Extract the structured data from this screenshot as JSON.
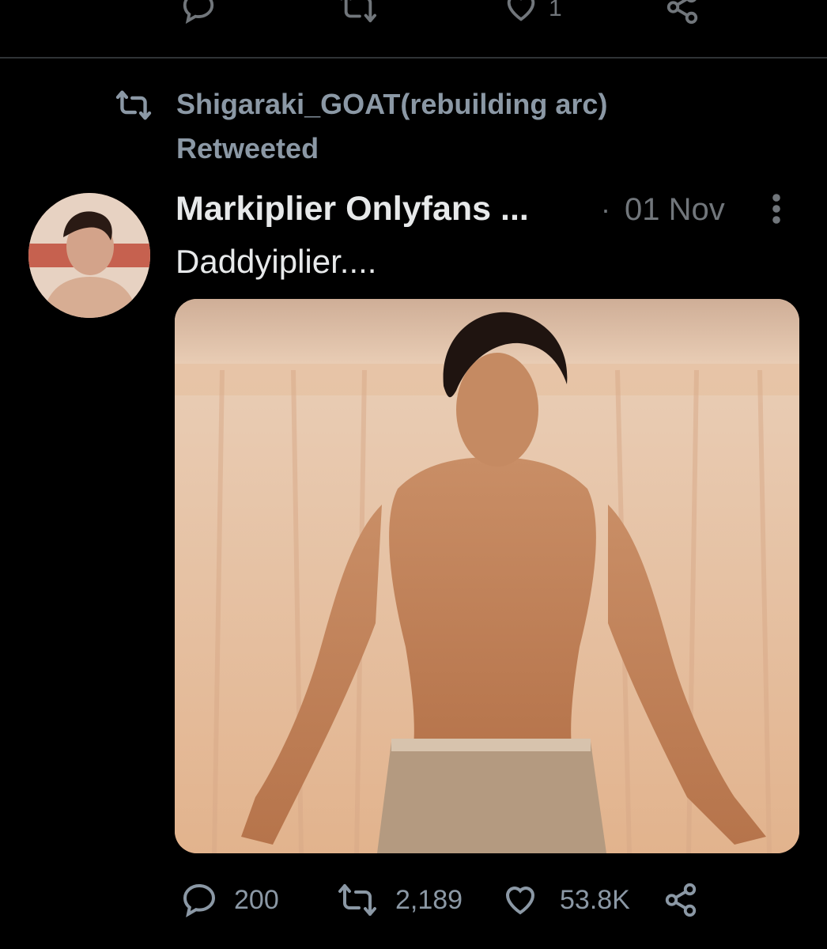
{
  "previous_tweet": {
    "actions": {
      "reply_icon": "reply-icon",
      "retweet_icon": "retweet-icon",
      "like_icon": "heart-icon",
      "like_count": "1",
      "share_icon": "share-icon"
    }
  },
  "retweet_context": {
    "icon": "retweet-icon",
    "user": "Shigaraki_GOAT(rebuilding arc)",
    "label": "Retweeted"
  },
  "tweet": {
    "author_name": "Markiplier Onlyfans ...",
    "separator": "·",
    "date": "01 Nov",
    "text": "Daddyiplier....",
    "media": "photo",
    "actions": {
      "reply_count": "200",
      "retweet_count": "2,189",
      "like_count": "53.8K",
      "share_icon": "share-icon"
    }
  },
  "colors": {
    "background": "#000000",
    "primary_text": "#e7e9ea",
    "secondary_text": "#71767b",
    "divider": "#2f3336"
  }
}
